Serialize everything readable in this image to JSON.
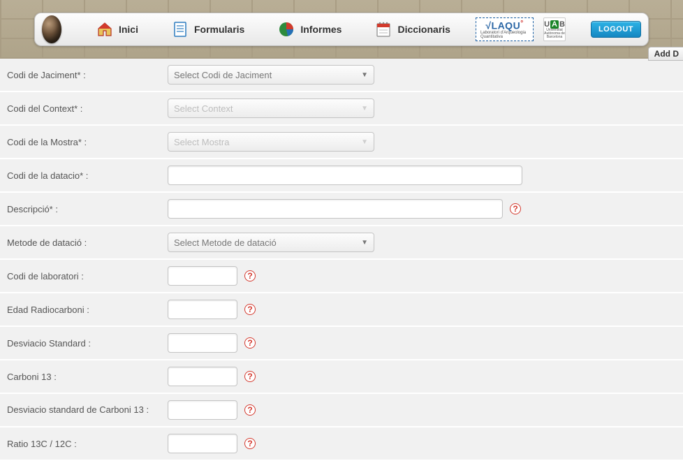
{
  "nav": {
    "inici": "Inici",
    "formularis": "Formularis",
    "informes": "Informes",
    "diccionaris": "Diccionaris",
    "logout": "LOGOUT",
    "laqu": "√LAQU",
    "laqu_sub": "Laboratori d'Arqueologia Quantitativa",
    "uab": "UAB",
    "uab_sub": "Universitat Autònoma de Barcelona"
  },
  "tab": {
    "add": "Add D"
  },
  "fields": {
    "jaciment": {
      "label": "Codi de Jaciment* :",
      "placeholder": "Select Codi de Jaciment"
    },
    "context": {
      "label": "Codi del Context* :",
      "placeholder": "Select Context"
    },
    "mostra": {
      "label": "Codi de la Mostra* :",
      "placeholder": "Select Mostra"
    },
    "datacio": {
      "label": "Codi de la datacio* :"
    },
    "descripcio": {
      "label": "Descripció* :"
    },
    "metode": {
      "label": "Metode de datació :",
      "placeholder": "Select Metode de datació"
    },
    "lab": {
      "label": "Codi de laboratori :"
    },
    "edat": {
      "label": "Edad Radiocarboni :"
    },
    "desv": {
      "label": "Desviacio Standard :"
    },
    "c13": {
      "label": "Carboni 13 :"
    },
    "desvc13": {
      "label": "Desviacio standard de Carboni 13 :"
    },
    "ratio": {
      "label": "Ratio 13C / 12C :"
    }
  }
}
